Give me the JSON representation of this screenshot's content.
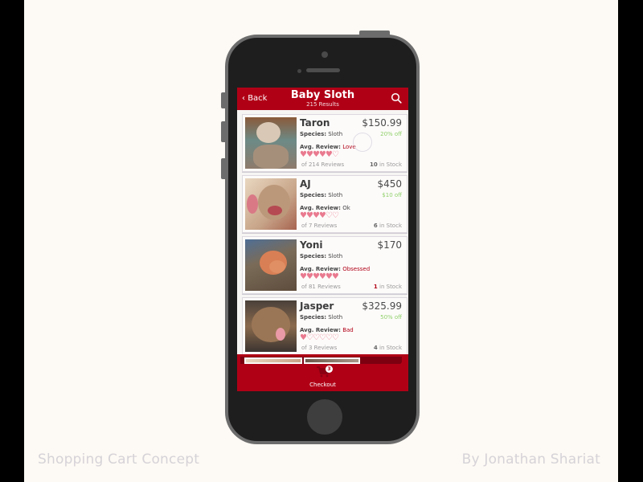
{
  "captions": {
    "left": "Shopping Cart Concept",
    "right": "By Jonathan Shariat"
  },
  "header": {
    "back_label": "Back",
    "back_icon": "chevron-left-icon",
    "title": "Baby Sloth",
    "subtitle": "215 Results",
    "search_icon": "search-icon"
  },
  "colors": {
    "brand": "#b00016",
    "brand_dark": "#7c0010",
    "discount": "#8fd16a",
    "heart": "#e97a8f",
    "background": "#fdf9f4",
    "phone_body": "#1e1e1e"
  },
  "labels": {
    "species": "Species:",
    "avg_review": "Avg. Review:",
    "in_stock": "in Stock"
  },
  "products": [
    {
      "name": "Taron",
      "price": "$150.99",
      "discount": "20% off",
      "species": "Sloth",
      "review": "Love",
      "rating": 5,
      "reviews": "of 214 Reviews",
      "stock": "10"
    },
    {
      "name": "AJ",
      "price": "$450",
      "discount": "$10 off",
      "species": "Sloth",
      "review": "Ok",
      "rating": 4,
      "reviews": "of 7 Reviews",
      "stock": "6"
    },
    {
      "name": "Yoni",
      "price": "$170",
      "discount": "",
      "species": "Sloth",
      "review": "Obsessed",
      "rating": 6,
      "reviews": "of 81 Reviews",
      "stock": "1"
    },
    {
      "name": "Jasper",
      "price": "$325.99",
      "discount": "50% off",
      "species": "Sloth",
      "review": "Bad",
      "rating": 1,
      "reviews": "of 3 Reviews",
      "stock": "4"
    }
  ],
  "rating_max": 6,
  "cart": {
    "count": "3",
    "checkout_label": "Checkout",
    "icon": "cart-icon"
  }
}
